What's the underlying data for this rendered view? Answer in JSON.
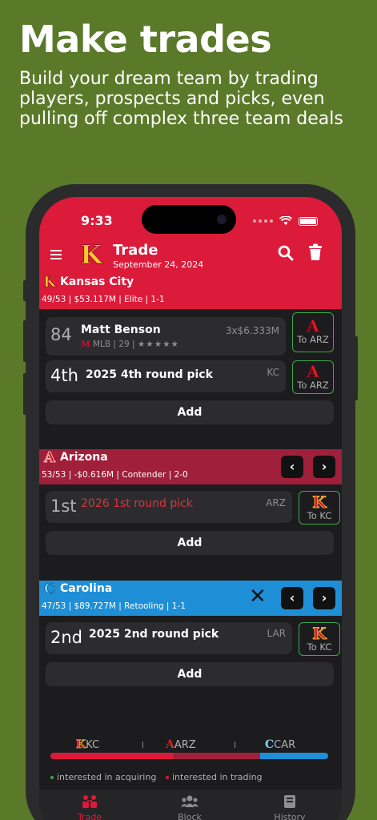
{
  "promo": {
    "headline": "Make trades",
    "subline": "Build your dream team by trading players, prospects and picks, even pulling off complex three team deals"
  },
  "status": {
    "time": "9:33"
  },
  "header": {
    "logo": "K",
    "title": "Trade",
    "date": "September 24, 2024",
    "icons": [
      "menu-icon",
      "search-icon",
      "trash-icon"
    ]
  },
  "teams": [
    {
      "logo": "K",
      "name": "Kansas City",
      "info": "49/53 | $53.117M | Elite | 1-1",
      "color": "#dc1a3a",
      "rows": [
        {
          "big": "84",
          "name": "Matt Benson",
          "right": "3x$6.333M",
          "meta": "MLB | 29 |",
          "stars": 5,
          "to_logo": "A",
          "to_label": "To ARZ"
        },
        {
          "big": "4th",
          "name": "2025 4th round pick",
          "right": "KC",
          "to_logo": "A",
          "to_label": "To ARZ"
        }
      ],
      "add_label": "Add"
    },
    {
      "logo": "A",
      "name": "Arizona",
      "info": "53/53 | -$0.616M | Contender | 2-0",
      "color": "#a01f3a",
      "rows": [
        {
          "big": "1st",
          "name": "2026 1st round pick",
          "right": "ARZ",
          "to_logo": "K",
          "to_label": "To KC"
        }
      ],
      "add_label": "Add"
    },
    {
      "logo": "C",
      "name": "Carolina",
      "info": "47/53 | $89.727M | Retooling | 1-1",
      "color": "#1e8fd6",
      "rows": [
        {
          "big": "2nd",
          "name": "2025 2nd round pick",
          "right": "LAR",
          "to_logo": "K",
          "to_label": "To KC"
        }
      ],
      "add_label": "Add"
    }
  ],
  "summary": {
    "labels": [
      {
        "logo": "K",
        "abbr": "KC"
      },
      {
        "logo": "A",
        "abbr": "ARZ"
      },
      {
        "logo": "C",
        "abbr": "CAR"
      }
    ],
    "shares": [
      0.4,
      0.28,
      0.22
    ],
    "legend": [
      "interested in acquiring",
      "interested in trading"
    ],
    "legend_colors": [
      "#3fa84a",
      "#dc1a3a"
    ]
  },
  "tabs": [
    {
      "label": "Trade",
      "icon": "trade-icon",
      "active": true
    },
    {
      "label": "Block",
      "icon": "people-icon",
      "active": false
    },
    {
      "label": "History",
      "icon": "book-icon",
      "active": false
    }
  ]
}
